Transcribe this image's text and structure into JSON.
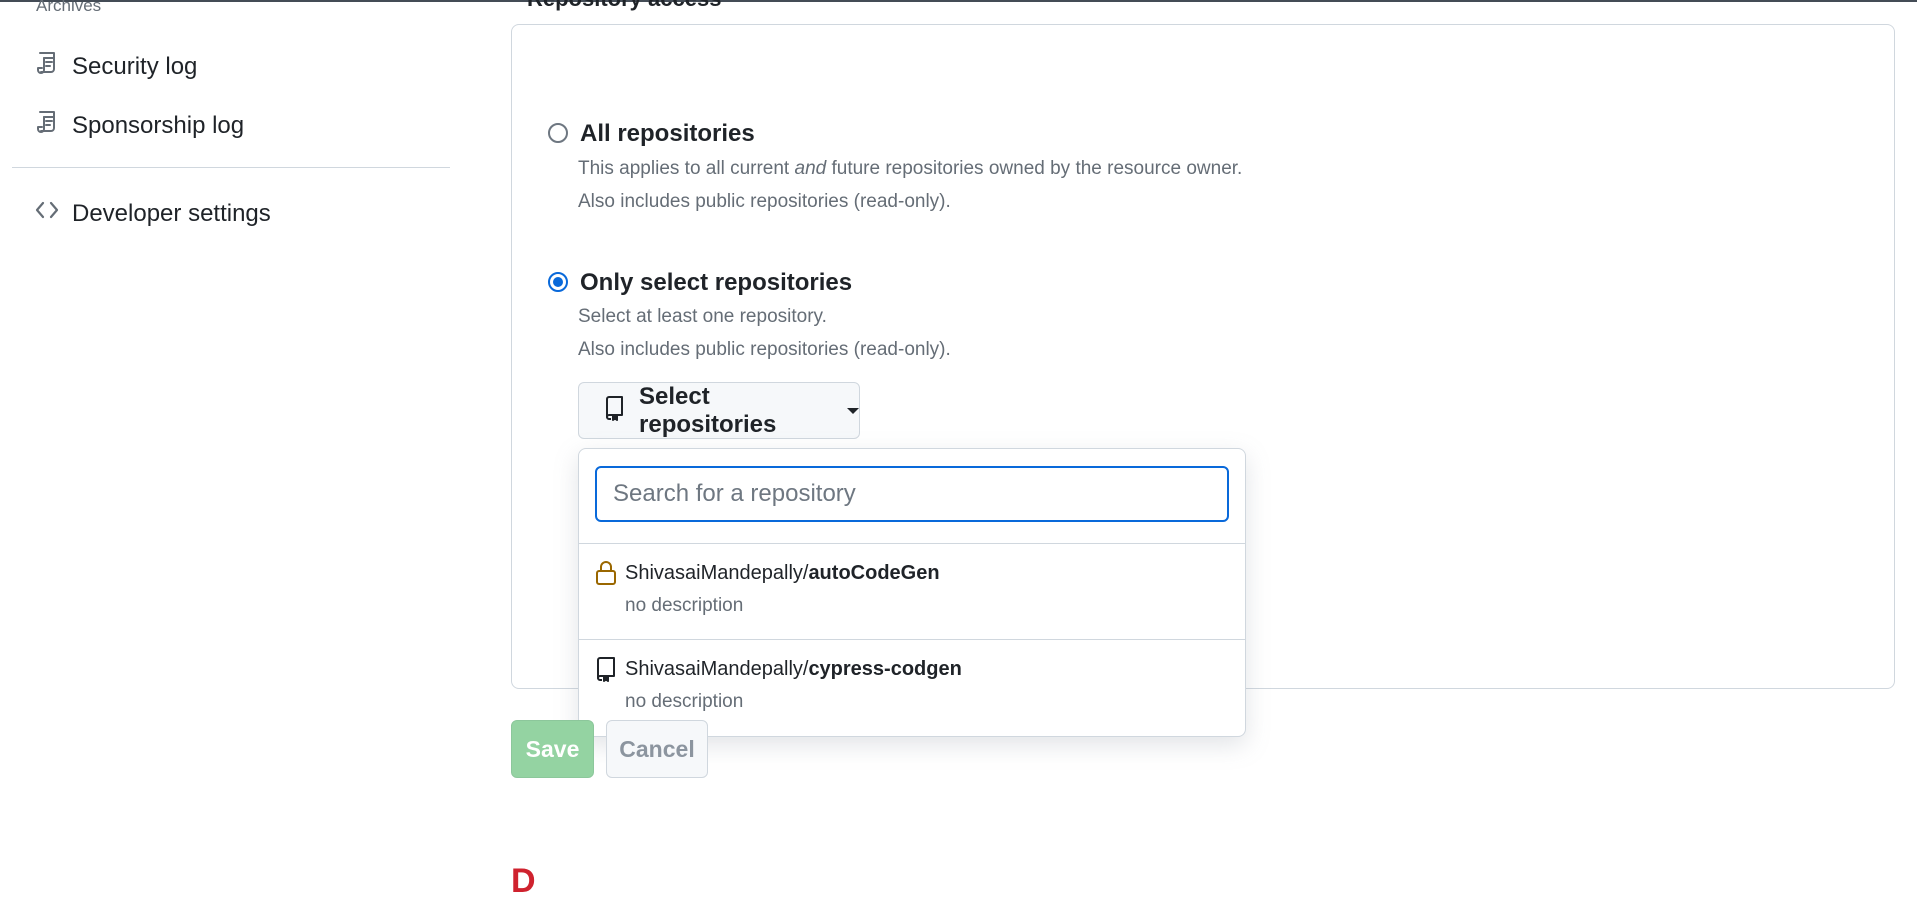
{
  "sidebar": {
    "section_label": "Archives",
    "items": [
      {
        "label": "Security log",
        "icon": "log-icon"
      },
      {
        "label": "Sponsorship log",
        "icon": "log-icon"
      },
      {
        "label": "Developer settings",
        "icon": "code-icon"
      }
    ]
  },
  "main": {
    "heading_peek": "Repository access",
    "options": [
      {
        "title": "All repositories",
        "desc_line1_pre": "This applies to all current ",
        "desc_line1_em": "and",
        "desc_line1_post": " future repositories owned by the resource owner.",
        "desc_line2": "Also includes public repositories (read-only).",
        "checked": false
      },
      {
        "title": "Only select repositories",
        "desc_line1": "Select at least one repository.",
        "desc_line2": "Also includes public repositories (read-only).",
        "checked": true
      }
    ],
    "select_button_label": "Select repositories",
    "dropdown": {
      "search_placeholder": "Search for a repository",
      "repos": [
        {
          "owner": "ShivasaiMandepally/",
          "name": "autoCodeGen",
          "description": "no description",
          "icon": "lock-icon",
          "icon_color": "#9a6700"
        },
        {
          "owner": "ShivasaiMandepally/",
          "name": "cypress-codgen",
          "description": "no description",
          "icon": "repo-icon",
          "icon_color": "#1f2328"
        }
      ]
    },
    "save_label": "Save",
    "cancel_label": "Cancel",
    "danger_peek": "D"
  },
  "colors": {
    "accent": "#0969da",
    "save_disabled": "#94d3a2",
    "danger": "#cf222e"
  }
}
